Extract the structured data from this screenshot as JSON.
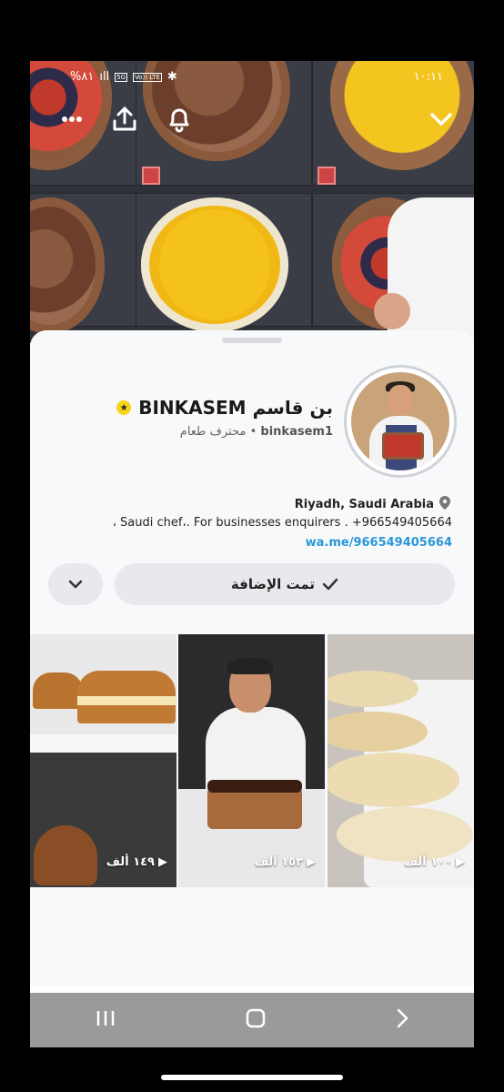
{
  "status_bar": {
    "battery": "%٨١",
    "network_badge_1": "5G",
    "network_badge_2": "Vo)) LTE",
    "time": "١٠:١١"
  },
  "profile": {
    "display_name": "BINKASEM بن قاسم",
    "username": "binkasem1",
    "category": "محترف طعام",
    "separator": "•",
    "location": "Riyadh, Saudi Arabia",
    "bio": "، Saudi chef،. For businesses enquirers . +966549405664",
    "link": "wa.me/966549405664"
  },
  "actions": {
    "added_label": "تمت الإضافة"
  },
  "videos": [
    {
      "views": "١٤٩ ألف"
    },
    {
      "views": "١٥٣ ألف"
    },
    {
      "views": "١٠٠ ألف"
    }
  ],
  "icons": {
    "more": "more-icon",
    "share": "share-icon",
    "bell": "bell-icon",
    "collapse": "chevron-down-icon",
    "location": "location-pin-icon",
    "check": "check-icon",
    "play": "play-icon",
    "star": "star-badge-icon"
  },
  "colors": {
    "link": "#2a97d8",
    "badge": "#f7d51a"
  }
}
